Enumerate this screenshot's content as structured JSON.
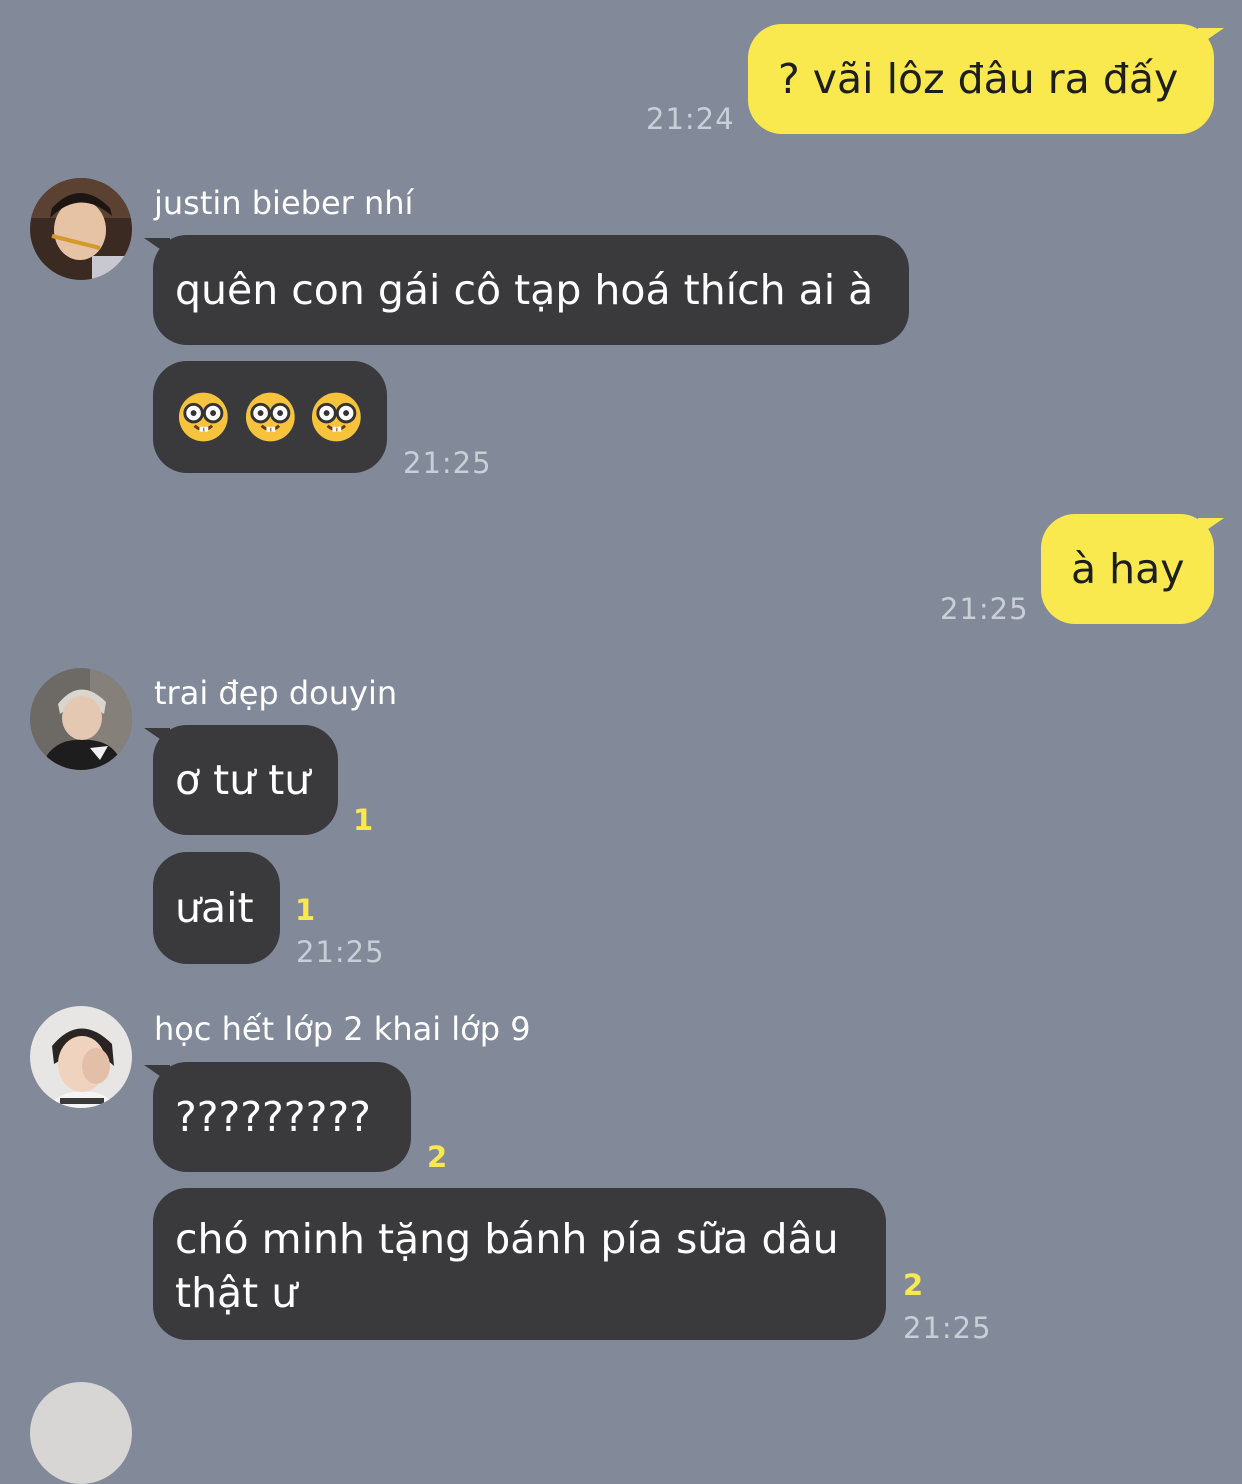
{
  "messages": {
    "m1": {
      "text": "? vãi lôz đâu ra đấy",
      "time": "21:24"
    },
    "m2": {
      "sender": "justin bieber nhí",
      "text": "quên con gái cô tạp hoá thích ai à",
      "emoji": "nerd-face",
      "time": "21:25"
    },
    "m3": {
      "text": "à hay",
      "time": "21:25"
    },
    "m4": {
      "sender": "trai đẹp douyin",
      "text1": "ơ tư tư",
      "unread1": "1",
      "text2": "ưait",
      "unread2": "1",
      "time": "21:25"
    },
    "m5": {
      "sender": "học hết lớp 2 khai lớp 9",
      "text1": "?????????",
      "unread1": "2",
      "text2": "chó minh tặng bánh pía sữa dâu thật ư",
      "unread2": "2",
      "time": "21:25"
    }
  },
  "colors": {
    "background": "#828a99",
    "my_bubble": "#f9e94e",
    "their_bubble": "#3a3a3c",
    "timestamp": "#c9ced7",
    "unread_count": "#f9e94e"
  }
}
